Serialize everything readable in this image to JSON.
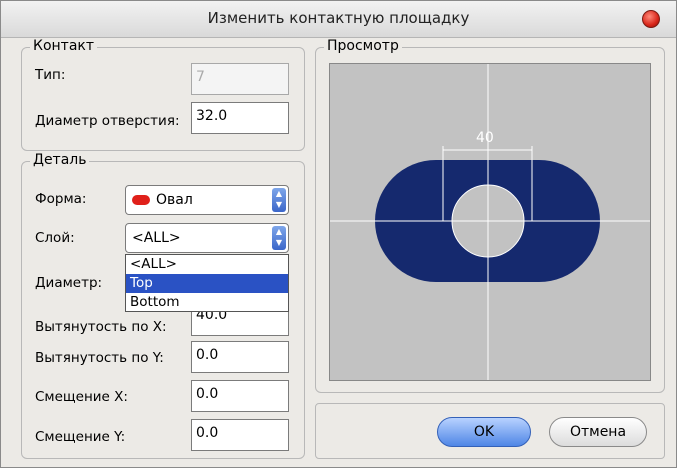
{
  "window": {
    "title": "Изменить контактную площадку"
  },
  "contact": {
    "group_title": "Контакт",
    "type_label": "Тип:",
    "type_value": "7",
    "hole_label": "Диаметр отверстия:",
    "hole_value": "32.0"
  },
  "detail": {
    "group_title": "Деталь",
    "shape_label": "Форма:",
    "shape_value": "Овал",
    "layer_label": "Слой:",
    "layer_value": "<ALL>",
    "layer_options": [
      "<ALL>",
      "Top",
      "Bottom"
    ],
    "layer_highlighted": "Top",
    "diameter_label": "Диаметр:",
    "stretch_x_label": "Вытянутость по X:",
    "stretch_x_value": "40.0",
    "stretch_y_label": "Вытянутость по Y:",
    "stretch_y_value": "0.0",
    "offset_x_label": "Смещение X:",
    "offset_x_value": "0.0",
    "offset_y_label": "Смещение Y:",
    "offset_y_value": "0.0"
  },
  "preview": {
    "group_title": "Просмотр",
    "dimension_label": "40",
    "pad_color": "#15296e",
    "background_color": "#c2c2c2"
  },
  "buttons": {
    "ok": "OK",
    "cancel": "Отмена"
  },
  "icons": {
    "close": "close-icon",
    "shape_swatch": "oval-shape-icon",
    "select_arrows": "updown-arrows-icon"
  }
}
